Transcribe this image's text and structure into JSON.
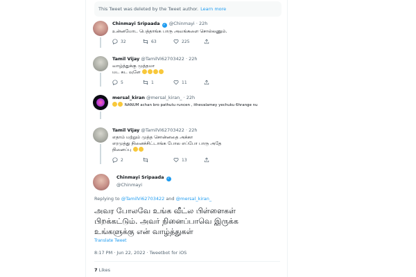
{
  "deleted_notice": {
    "text": "This Tweet was deleted by the Tweet author.",
    "link": "Learn more"
  },
  "tweets": [
    {
      "name": "Chinmayi Sripaada",
      "handle": "@Chinmayi",
      "time": "22h",
      "verified": true,
      "text": "உன்னமோட பெத்தாங்க பாரு அவங்களை சொல்லணும்.",
      "reply_count": "32",
      "retweet_count": "63",
      "like_count": "225"
    },
    {
      "name": "Tamil Vijay",
      "handle": "@TamilVi62703422",
      "time": "22h",
      "text_line1": "வாழ்த்துக்கு முத்தமா",
      "text_line2": "மட கட வுளே",
      "emoji_count": 4,
      "reply_count": "5",
      "retweet_count": "1",
      "like_count": "11"
    },
    {
      "name": "mersal_kiran",
      "handle": "@mersal_kiran_",
      "time": "22h",
      "text": "NANUM achan bro pathutu runcen , ithevalamey yechuku 6hrange nu",
      "emoji_count": 2
    },
    {
      "name": "Tamil Vijay",
      "handle": "@TamilVi62703422",
      "time": "22h",
      "text_line1": "எதாம் மற்றும் முத்த சொன்னதை அக்கா",
      "text_line2": "எரமுத்து நினைச்சிட்டாங்க போல எப்போ பாரு அதே",
      "text_line3": "நினைப்பு",
      "emoji_count": 2,
      "reply_count": "2",
      "retweet_count": "",
      "like_count": "13"
    }
  ],
  "main_tweet": {
    "name": "Chinmayi Sripaada",
    "handle": "@Chinmayi",
    "replying_prefix": "Replying to",
    "replying_user1": "@TamilVi62703422",
    "replying_and": "and",
    "replying_user2": "@mersal_kiran_",
    "line1": "அவர போலவே உங்க வீட்ல பிள்ளைகள்",
    "line2": "பிறக்கட்டும். அவர் நினைப்பாவெ இருக்க",
    "line3": "உங்களுக்கு என் வாழ்த்துகள்",
    "translate": "Translate Tweet",
    "time": "8:17 PM",
    "date": "Jun 22, 2022",
    "source": "Tweetbot for iOS",
    "likes_count": "7",
    "likes_label": "Likes"
  },
  "colors": {
    "accent": "#1d9bf0",
    "muted": "#536471",
    "text": "#0f1419"
  }
}
